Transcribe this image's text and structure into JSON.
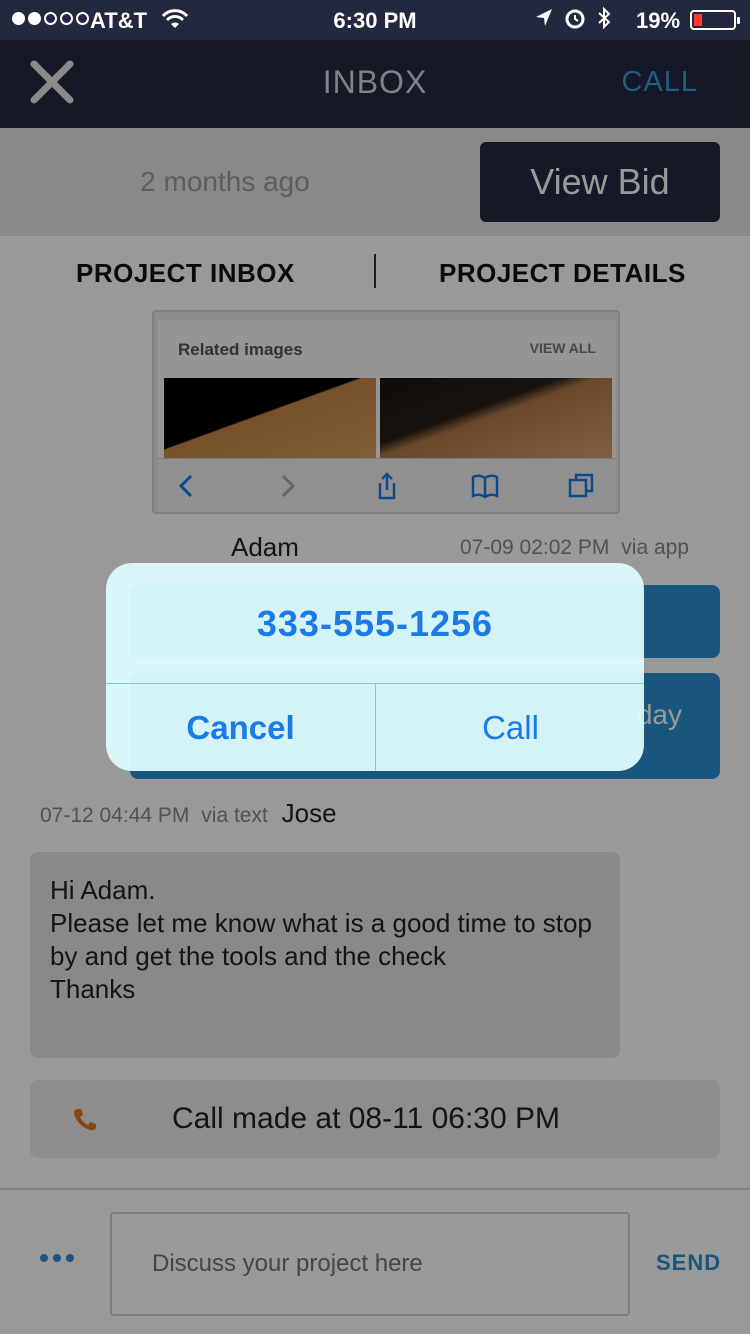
{
  "status_bar": {
    "carrier": "AT&T",
    "time": "6:30 PM",
    "battery": "19%",
    "signal_bars_filled": 2,
    "signal_bars_total": 5,
    "battery_level": 0.19
  },
  "nav": {
    "title": "INBOX",
    "call_label": "CALL",
    "close_icon": "close-icon"
  },
  "bid": {
    "time_ago": "2 months ago",
    "view_bid_label": "View Bid"
  },
  "tabs": [
    {
      "label": "PROJECT INBOX"
    },
    {
      "label": "PROJECT DETAILS"
    }
  ],
  "image_card": {
    "related_label": "Related images",
    "view_all_label": "VIEW ALL"
  },
  "messages": {
    "adam": {
      "name": "Adam",
      "timestamp": "07-09 02:02 PM",
      "via": "via app",
      "partial_text": "day"
    },
    "jose": {
      "timestamp": "07-12 04:44 PM",
      "via": "via text",
      "name": "Jose",
      "text": "Hi Adam.\nPlease let me know what is a good time to stop by and get the tools and the check\nThanks"
    },
    "call_made": "Call made at 08-11 06:30 PM"
  },
  "composer": {
    "placeholder": "Discuss your project here",
    "send_label": "SEND"
  },
  "alert": {
    "phone_number": "333-555-1256",
    "cancel_label": "Cancel",
    "call_label": "Call"
  },
  "colors": {
    "navy": "#232841",
    "accent_blue": "#2a8fd0",
    "ios_blue": "#1a7be8",
    "phone_orange": "#e0761e"
  }
}
